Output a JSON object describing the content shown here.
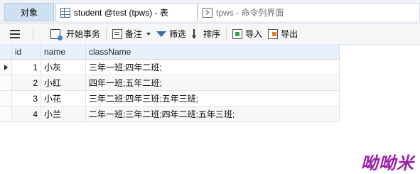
{
  "tabs": {
    "objects": "对象",
    "table": "student @test (tpws) - 表",
    "console": "tpws - 命令列界面"
  },
  "toolbar": {
    "begin_transaction": "开始事务",
    "memo": "备注",
    "filter": "筛选",
    "sort": "排序",
    "import": "导入",
    "export": "导出"
  },
  "table": {
    "columns": [
      "id",
      "name",
      "className"
    ],
    "rows": [
      {
        "id": "1",
        "name": "小灰",
        "className": "三年一班;四年二班;"
      },
      {
        "id": "2",
        "name": "小红",
        "className": "四年一班;五年二班;"
      },
      {
        "id": "3",
        "name": "小花",
        "className": "三年二班;四年三班;五年三班;"
      },
      {
        "id": "4",
        "name": "小兰",
        "className": "二年一班;三年二班;四年二班;五年三班;"
      }
    ]
  },
  "watermark": "呦呦米"
}
